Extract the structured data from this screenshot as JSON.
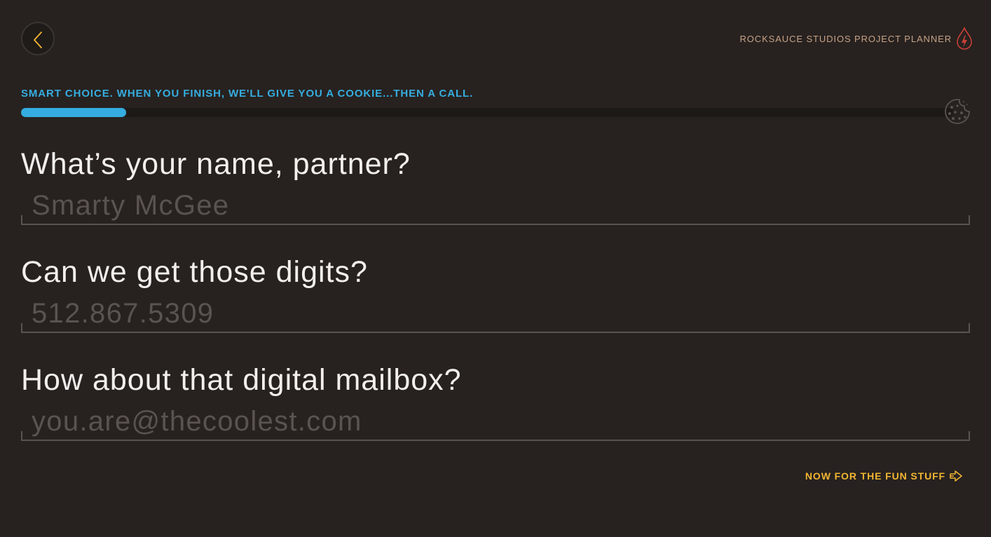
{
  "header": {
    "back_icon": "chevron-left-icon",
    "brand_title": "ROCKSAUCE STUDIOS PROJECT PLANNER",
    "brand_icon": "flame-bolt-icon",
    "brand_icon_color": "#c94035",
    "back_icon_color": "#f2b632"
  },
  "progress": {
    "message": "SMART CHOICE. WHEN YOU FINISH, WE'LL GIVE YOU A COOKIE...THEN A CALL.",
    "percent": 11.3,
    "color": "#35ade0",
    "end_icon": "cookie-icon"
  },
  "form": {
    "questions": [
      {
        "label": "What’s your name, partner?",
        "value": "",
        "placeholder": "Smarty McGee"
      },
      {
        "label": "Can we get those digits?",
        "value": "",
        "placeholder": "512.867.5309"
      },
      {
        "label": "How about that digital mailbox?",
        "value": "",
        "placeholder": "you.are@thecoolest.com"
      }
    ]
  },
  "footer": {
    "next_label": "NOW FOR THE FUN STUFF",
    "next_icon": "arrow-right-icon",
    "accent_color": "#f2b632"
  }
}
